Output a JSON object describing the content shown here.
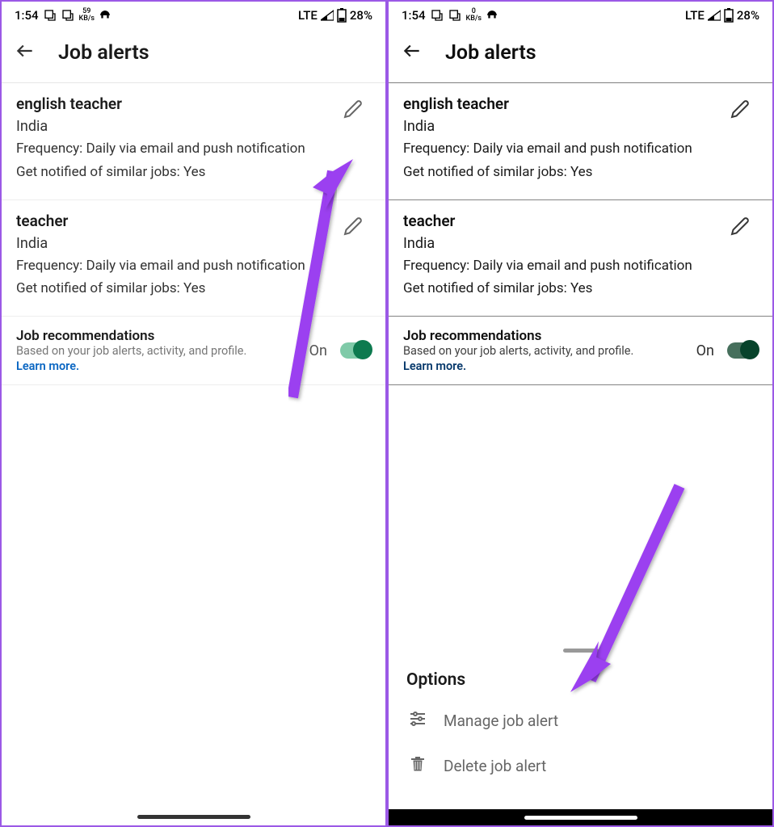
{
  "status": {
    "time": "1:54",
    "kbs_left": "59",
    "kbs_right": "0",
    "kbs_unit": "KB/s",
    "network": "LTE",
    "battery": "28%"
  },
  "header": {
    "title": "Job alerts"
  },
  "alerts": [
    {
      "title": "english teacher",
      "location": "India",
      "frequency": "Frequency: Daily via email and push notification",
      "notify": "Get notified of similar jobs: Yes"
    },
    {
      "title": "teacher",
      "location": "India",
      "frequency": "Frequency: Daily via email and push notification",
      "notify": "Get notified of similar jobs: Yes"
    }
  ],
  "recommendations": {
    "title": "Job recommendations",
    "subtitle": "Based on your job alerts, activity, and profile.",
    "learn": "Learn more.",
    "state": "On"
  },
  "sheet": {
    "title": "Options",
    "manage": "Manage job alert",
    "delete": "Delete job alert"
  }
}
